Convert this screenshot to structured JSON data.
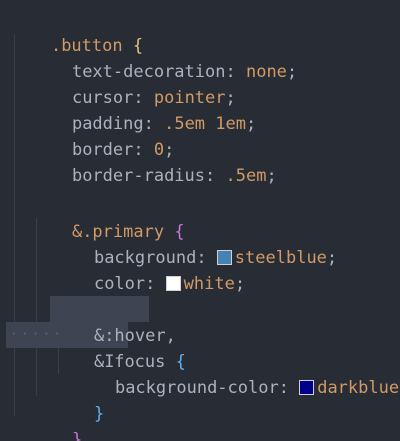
{
  "editor": {
    "line1": {
      "selector": ".button",
      "brace": "{"
    },
    "line2": {
      "prop": "text-decoration",
      "value": "none"
    },
    "line3": {
      "prop": "cursor",
      "value": "pointer"
    },
    "line4": {
      "prop": "padding",
      "value": ".5em 1em"
    },
    "line5": {
      "prop": "border",
      "value": "0"
    },
    "line6": {
      "prop": "border-radius",
      "value": ".5em"
    },
    "line8": {
      "selector": "&.primary",
      "brace": "{"
    },
    "line9": {
      "prop": "background",
      "value": "steelblue",
      "swatch": "#4682b4"
    },
    "line10": {
      "prop": "color",
      "value": "white",
      "swatch": "#ffffff"
    },
    "line12": {
      "selector": "&:hover,"
    },
    "line13": {
      "selector_pre": "&",
      "selector_post": "focus",
      "brace": "{",
      "ghost": "·····"
    },
    "line14": {
      "prop": "background-color",
      "value": "darkblue",
      "swatch": "#00008b"
    },
    "line15": {
      "brace": "}"
    },
    "line16": {
      "brace": "}"
    }
  }
}
